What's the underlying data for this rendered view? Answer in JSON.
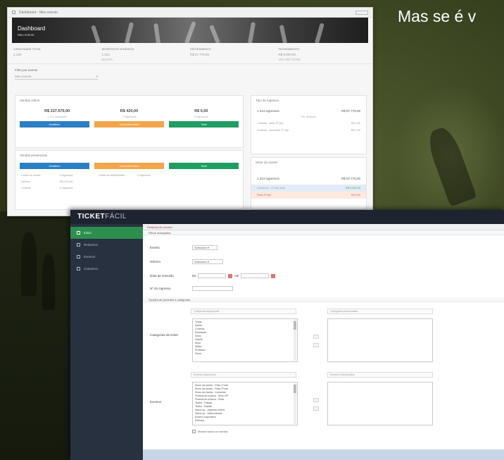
{
  "headline": "Mas se é v",
  "dashboard": {
    "tab_title": "Dashboard - Meu evento",
    "banner_title": "Dashboard",
    "banner_subtitle": "Meu evento",
    "stats": [
      {
        "label": "CAPACIDADE TOTAL",
        "value": "2.100",
        "sub": ""
      },
      {
        "label": "INGRESSOS VENDIDOS",
        "value": "1.314",
        "sub": "62,57%"
      },
      {
        "label": "FATURAMENTO",
        "value": "R$ 97.775,00",
        "sub": ""
      },
      {
        "label": "FATURAMENTO",
        "value": "R$ 9.000,00",
        "sub": "19% DO TOTAL"
      }
    ],
    "filter_label": "Filtro por evento",
    "filter_value": "Meu evento",
    "sales_panel_title": "Vendas online",
    "kpis": [
      {
        "value": "R$ 237.575,00",
        "sub": "1.314 ingressos"
      },
      {
        "value": "R$ 420,00",
        "sub": "7 ingressos"
      },
      {
        "value": "R$ 0,00",
        "sub": "0 ingressos"
      }
    ],
    "buttons": [
      "Detalhes",
      "Cancelamentos",
      "Total"
    ],
    "second_panel_title": "Vendas presenciais",
    "buttons2": [
      "Detalhes",
      "Cancelamentos",
      "Total"
    ],
    "mini_rows": [
      [
        "Cartão de crédito",
        "0 ingressos",
        "Cartão de débito/boleto",
        "0 ingressos"
      ],
      [
        "Dinheiro",
        "R$ 0,00 (0)"
      ],
      [
        "Cortesia",
        "0 ingressos"
      ]
    ],
    "side_panel1": {
      "title": "Tipo de ingresso",
      "row_left": "1.314 ingressos",
      "row_right": "R$ 97.775,00",
      "center": "Ver detalhes",
      "lines": [
        [
          "Cortesia - pista 3º lote",
          "R$ 0,00"
        ],
        [
          "Cortesia - camarote 2º lote",
          "R$ 0,00"
        ]
      ]
    },
    "side_panel2": {
      "title": "Setor do evento",
      "row_left": "1.314 ingressos",
      "row_right": "R$ 97.775,00",
      "hl1_left": "Camarote - 1º lote meia",
      "hl1_right": "R$ 9.000,00",
      "hl2_left": "Pista 2º lote",
      "hl2_right": "R$ 0,00"
    }
  },
  "ticketfacil": {
    "logo_main": "TICKET",
    "logo_accent": "FÁCIL",
    "nav": [
      "Início",
      "Relatórios",
      "Eventos",
      "Cadastros"
    ],
    "breadcrumb": "Relatório de vendas",
    "section": "Filtros avançados",
    "fields": {
      "evento_label": "Evento",
      "evento_value": "Selecione",
      "genero_label": "Gênero",
      "genero_value": "Selecione",
      "data_label": "Data de emissão",
      "de_label": "De",
      "ate_label": "Até",
      "ingresso_label": "Nº do ingresso"
    },
    "section2": "Opções de produtos e categorias",
    "categorias_label": "Categorias de ticket",
    "categorias_header": "Categorias disponíveis",
    "categorias_sel_header": "Categorias selecionadas",
    "categorias": [
      "Todas",
      "Adulto",
      "Cortesia",
      "Estudante",
      "Idoso",
      "Infantil",
      "Meia",
      "Militar",
      "Professor",
      "Sócio"
    ],
    "eventos_label": "Eventos",
    "eventos_header": "Eventos disponíveis",
    "eventos_sel_header": "Eventos selecionados",
    "eventos": [
      "Show da banda - Pista 1º lote",
      "Show da banda - Pista 2º lote",
      "Show da banda - Camarote",
      "Festival de música - Área VIP",
      "Festival de música - Pista",
      "Teatro - Plateia",
      "Teatro - Balcão",
      "Stand up - Ingresso inteira",
      "Stand up - Meia entrada",
      "Evento corporativo",
      "Palestra"
    ],
    "checkbox_label": "Mostrar todos os eventos"
  }
}
